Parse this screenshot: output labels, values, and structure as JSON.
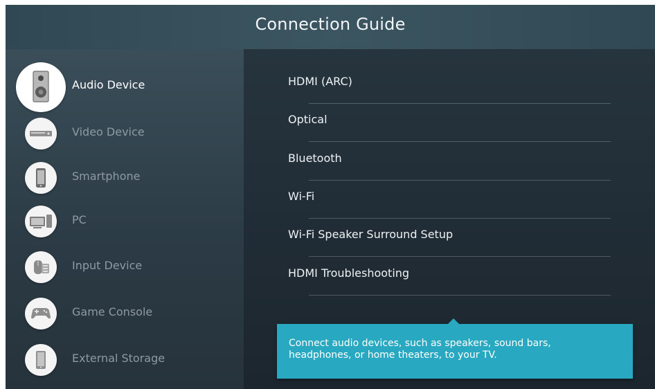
{
  "title": "Connection Guide",
  "categories": [
    {
      "label": "Audio Device",
      "icon": "speaker-icon",
      "selected": true
    },
    {
      "label": "Video Device",
      "icon": "video-player-icon",
      "selected": false
    },
    {
      "label": "Smartphone",
      "icon": "smartphone-icon",
      "selected": false
    },
    {
      "label": "PC",
      "icon": "pc-icon",
      "selected": false
    },
    {
      "label": "Input Device",
      "icon": "keyboard-mouse-icon",
      "selected": false
    },
    {
      "label": "Game Console",
      "icon": "gamepad-icon",
      "selected": false
    },
    {
      "label": "External Storage",
      "icon": "external-storage-icon",
      "selected": false
    }
  ],
  "options": [
    {
      "label": "HDMI (ARC)"
    },
    {
      "label": "Optical"
    },
    {
      "label": "Bluetooth"
    },
    {
      "label": "Wi-Fi"
    },
    {
      "label": "Wi-Fi Speaker Surround Setup"
    },
    {
      "label": "HDMI Troubleshooting"
    }
  ],
  "tooltip": {
    "text": "Connect audio devices, such as speakers, sound bars, headphones, or home theaters, to your TV."
  },
  "colors": {
    "tooltip_bg": "#29a8c2",
    "selected_text": "#ffffff",
    "unselected_text": "#8d9aa3"
  }
}
